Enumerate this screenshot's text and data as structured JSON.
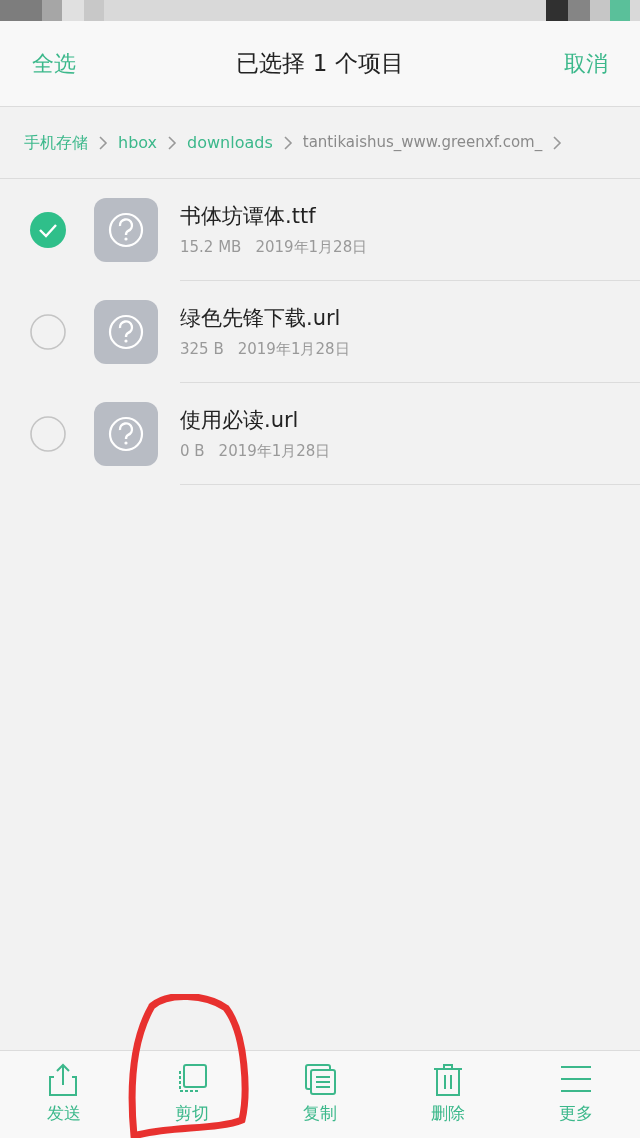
{
  "header": {
    "select_all": "全选",
    "title": "已选择 1 个项目",
    "cancel": "取消"
  },
  "breadcrumb": [
    {
      "label": "手机存储",
      "current": false
    },
    {
      "label": "hbox",
      "current": false
    },
    {
      "label": "downloads",
      "current": false
    },
    {
      "label": "tantikaishus_www.greenxf.com_",
      "current": true
    }
  ],
  "files": [
    {
      "name": "书体坊谭体.ttf",
      "size": "15.2 MB",
      "date": "2019年1月28日",
      "selected": true
    },
    {
      "name": "绿色先锋下载.url",
      "size": "325 B",
      "date": "2019年1月28日",
      "selected": false
    },
    {
      "name": "使用必读.url",
      "size": "0 B",
      "date": "2019年1月28日",
      "selected": false
    }
  ],
  "toolbar": [
    {
      "kind": "share",
      "label": "发送"
    },
    {
      "kind": "cut",
      "label": "剪切"
    },
    {
      "kind": "copy",
      "label": "复制"
    },
    {
      "kind": "delete",
      "label": "删除"
    },
    {
      "kind": "more",
      "label": "更多"
    }
  ]
}
